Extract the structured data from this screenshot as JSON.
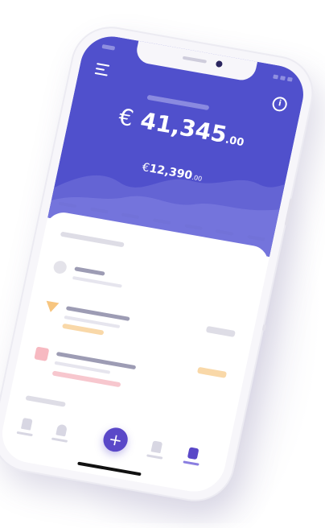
{
  "app": {
    "currency_symbol": "€",
    "main_balance": {
      "integer": "41,345",
      "decimals": ".00"
    },
    "secondary_balance": {
      "integer": "12,390",
      "decimals": ".00"
    }
  },
  "tabbar": {
    "add_label": "+"
  },
  "icons": {
    "menu": "hamburger-menu-icon",
    "info": "info-icon",
    "add": "plus-icon"
  },
  "colors": {
    "header": "#5050cc",
    "accent": "#5a48c8",
    "warning": "#f7c57f",
    "danger": "#f7b9c1",
    "avatar": "#d6c8f3"
  }
}
